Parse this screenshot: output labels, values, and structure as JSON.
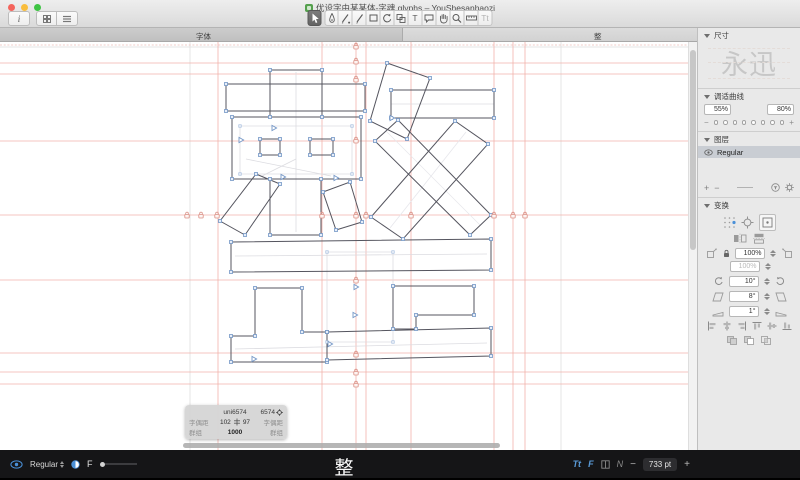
{
  "window": {
    "title": "优设字由某某体-字魂.glyphs – YouShesanhaozi"
  },
  "titlebar": {
    "info_button": "i"
  },
  "tabs": {
    "font": "字体",
    "glyph": "整"
  },
  "tools": {
    "text": "T",
    "instructor": "Tt"
  },
  "sidebar": {
    "dimensions": {
      "title": "尺寸",
      "preview": "永迅"
    },
    "fit_curve": {
      "title": "调适曲线",
      "min": "55%",
      "max": "80%",
      "minus": "−",
      "plus": "+"
    },
    "layers": {
      "title": "图层",
      "selected": "Regular",
      "add": "+",
      "remove": "−"
    },
    "transform": {
      "title": "变换",
      "scale_h": "100%",
      "scale_v": "100%",
      "rotate": "10°",
      "slant": "8°",
      "slant2": "1°"
    }
  },
  "infobox": {
    "glyph_name": "uni6574",
    "unicode": "6574",
    "kern_label_left": "字偶距",
    "kern_label_right": "字偶距",
    "group_label_left": "群组",
    "group_label_right": "群组",
    "lsb": "102",
    "rsb": "97",
    "width": "1000"
  },
  "bottombar": {
    "instance": "Regular",
    "contrast_f": "F",
    "glyph": "整",
    "tt_icon": "Tt",
    "f_icon": "F",
    "n_icon": "N",
    "zoom_out": "−",
    "zoom_value": "733 pt",
    "zoom_in": "+"
  },
  "colors": {
    "accent_blue": "#5a9bd8",
    "guide_red": "#f2b2ab",
    "lock_red": "#d98d82"
  }
}
